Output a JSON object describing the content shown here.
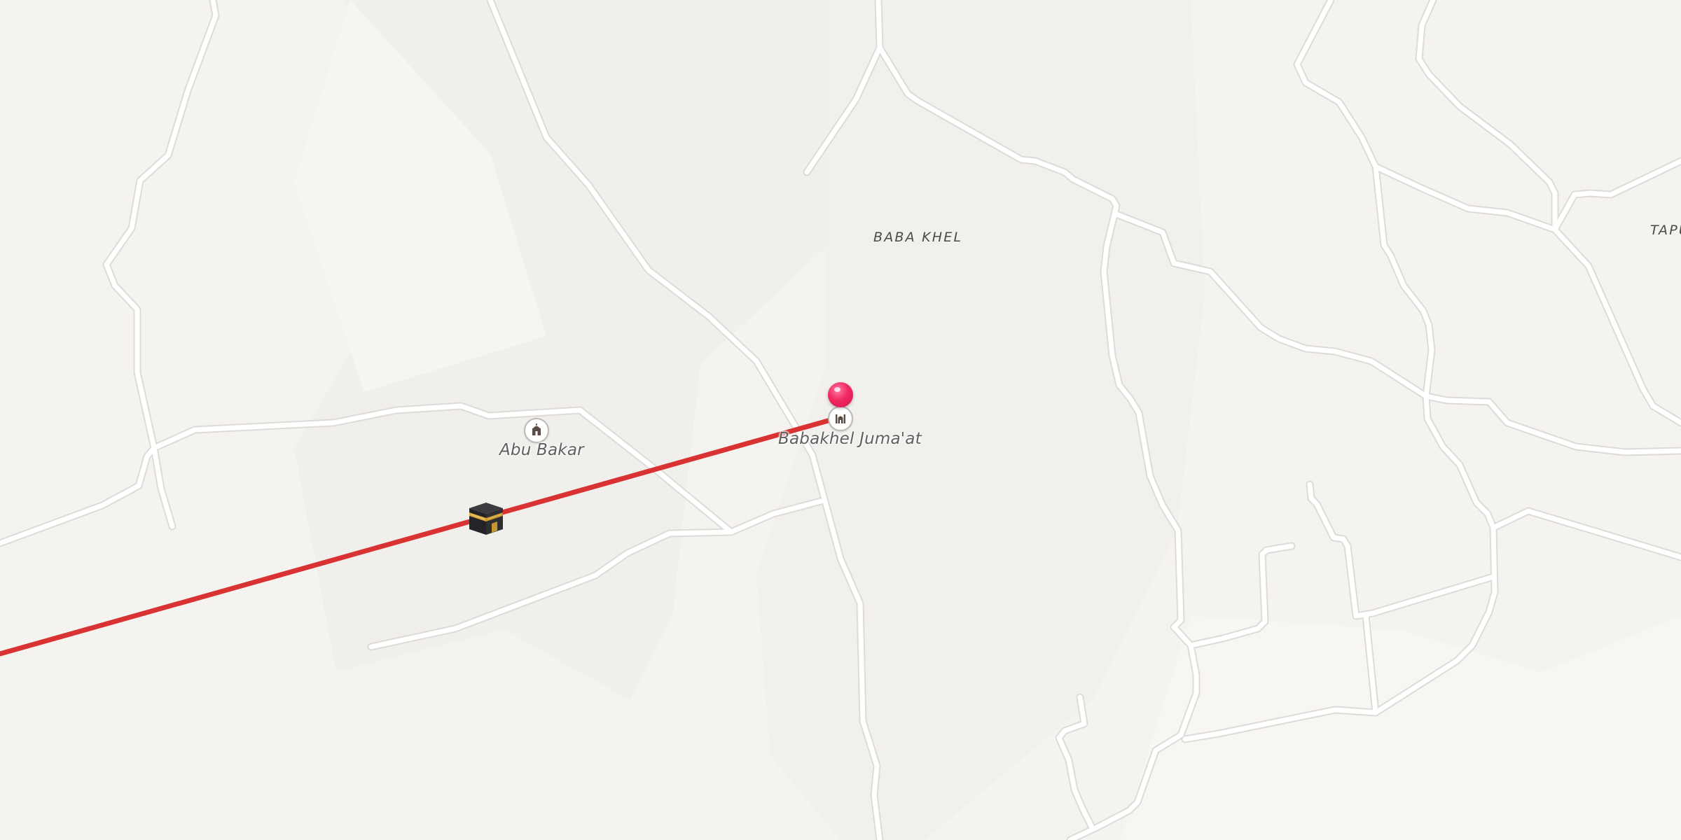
{
  "map": {
    "labels": {
      "area_main": "BABA KHEL",
      "area_edge": "TAPU",
      "poi_abu_bakar": "Abu Bakar",
      "poi_babakhel": "Babakhel Juma'at"
    },
    "icons": {
      "poi_abu_bakar": "mosque-icon",
      "poi_babakhel": "mosque-icon",
      "selected_pin": "location-pin-icon",
      "qibla_target": "kaaba-icon"
    },
    "colors": {
      "background": "#f5f3f0",
      "road": "#ffffff",
      "road_casing": "#dedbd7",
      "qibla_line": "#d93232",
      "pin": "#f2275f",
      "label_text": "#5f5f5f"
    }
  }
}
